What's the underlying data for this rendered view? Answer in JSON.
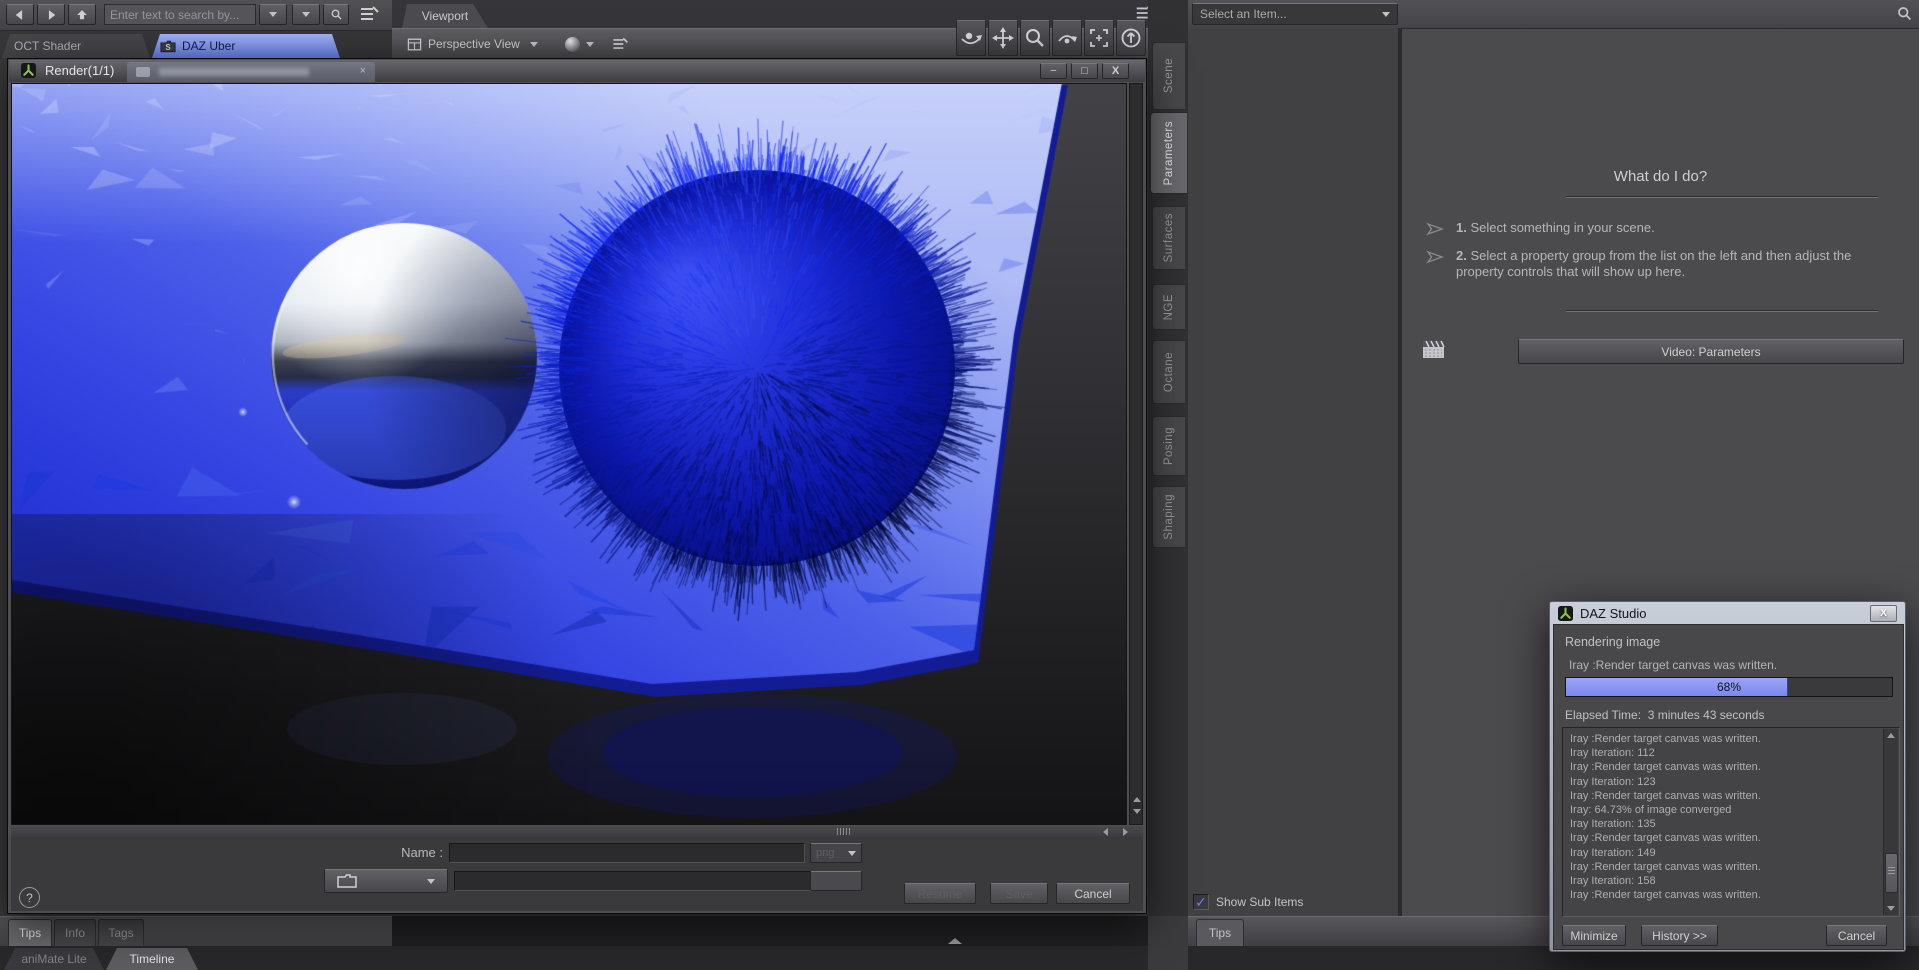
{
  "topbar": {
    "search_placeholder": "Enter text to search by...",
    "icons": {
      "back": "left-arrow",
      "forward": "right-arrow",
      "up": "up-arrow",
      "dropdown": "caret-down",
      "search": "magnifier",
      "pane_options": "pane-option-lines"
    }
  },
  "shader_tabs": {
    "items": [
      {
        "label": "OCT Shader",
        "active": false
      },
      {
        "label": "DAZ Uber",
        "active": true
      }
    ]
  },
  "viewport": {
    "tab": "Viewport",
    "view_selector": "Perspective View",
    "nav_icons": [
      "orbit",
      "pan",
      "zoom",
      "arc-rotate",
      "frame",
      "aim-home"
    ]
  },
  "render_window": {
    "title": "Render(1/1)",
    "name_label": "Name :",
    "name_value": "",
    "path_value": "",
    "format": "png",
    "help_glyph": "?",
    "buttons": {
      "resume": "Resume",
      "save": "Save",
      "cancel": "Cancel"
    },
    "controls": {
      "minimize": "−",
      "maximize": "□",
      "close": "X"
    }
  },
  "right_panel": {
    "item_selector": "Select an Item...",
    "vertical_tabs": [
      "Scene",
      "Parameters",
      "Surfaces",
      "NGE",
      "Octane",
      "Posing",
      "Shaping"
    ],
    "active_tab": "Parameters",
    "help_card": {
      "title": "What do I do?",
      "step1_num": "1.",
      "step1_text": " Select something in your scene.",
      "step2_num": "2.",
      "step2_text": " Select a property group from the list on the left and then adjust the property controls that will show up here."
    },
    "video_button": "Video: Parameters",
    "show_sub_items": "Show Sub Items",
    "check_glyph": "✓",
    "bottom_tab": "Tips"
  },
  "progress_dialog": {
    "title": "DAZ Studio",
    "close": "X",
    "status": "Rendering image",
    "message": "Iray :Render target canvas was written.",
    "progress_pct": 68,
    "progress_label": "68%",
    "elapsed": "Elapsed Time:  3 minutes 43 seconds",
    "log": [
      "Iray :Render target canvas was written.",
      "Iray Iteration: 112",
      "Iray :Render target canvas was written.",
      "Iray Iteration: 123",
      "Iray :Render target canvas was written.",
      "Iray: 64.73% of image converged",
      "Iray Iteration: 135",
      "Iray :Render target canvas was written.",
      "Iray Iteration: 149",
      "Iray :Render target canvas was written.",
      "Iray Iteration: 158",
      "Iray :Render target canvas was written."
    ],
    "buttons": {
      "minimize": "Minimize",
      "history": "History >>",
      "cancel": "Cancel"
    }
  },
  "bottom_bar": {
    "doc_tabs": [
      {
        "label": "Tips",
        "active": true
      },
      {
        "label": "Info",
        "active": false
      },
      {
        "label": "Tags",
        "active": false
      }
    ],
    "timeline_tabs": [
      {
        "label": "aniMate Lite",
        "active": false
      },
      {
        "label": "Timeline",
        "active": true
      }
    ]
  },
  "colors": {
    "selection_blue": "#7e93ea",
    "progress_fill": "#8a94f2",
    "daz_green": "#8bc63f",
    "render_blue": "#2b3de0",
    "render_deep_blue": "#0a14a0"
  }
}
